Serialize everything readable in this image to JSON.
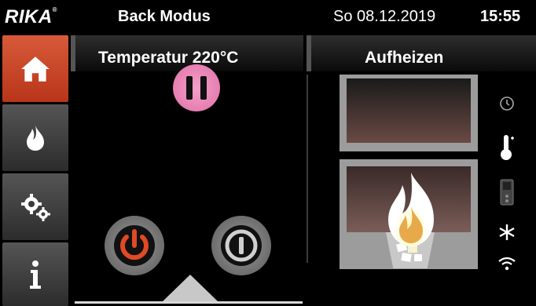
{
  "header": {
    "logo": "RIKA",
    "mode": "Back Modus",
    "date": "So 08.12.2019",
    "time": "15:55"
  },
  "sidebar": {
    "items": [
      {
        "name": "home",
        "active": true
      },
      {
        "name": "flame",
        "active": false
      },
      {
        "name": "settings",
        "active": false
      },
      {
        "name": "info",
        "active": false
      }
    ]
  },
  "left_panel": {
    "title": "Temperatur 220°C"
  },
  "right_panel": {
    "title": "Aufheizen",
    "status_icons": [
      "clock-icon",
      "thermometer-icon",
      "remote-icon",
      "snowflake-icon",
      "wifi-icon"
    ]
  },
  "colors": {
    "accent": "#d04a2a",
    "bar": "#555555"
  }
}
